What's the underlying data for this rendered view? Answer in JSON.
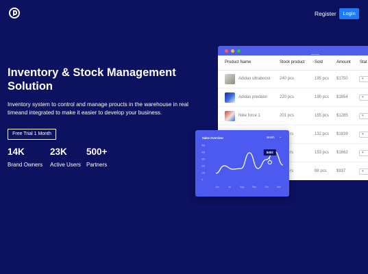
{
  "nav": {
    "register_label": "Register",
    "login_label": "Login"
  },
  "hero": {
    "title": "Inventory & Stock Management Solution",
    "description": "Inventory system to control and manage proucts in the warehouse in real timeand integrated to make it easier to develop your business.",
    "cta_label": "Free Trial 1 Month"
  },
  "stats": [
    {
      "value": "14K",
      "label": "Brand Owners"
    },
    {
      "value": "23K",
      "label": "Active Users"
    },
    {
      "value": "500+",
      "label": "Partners"
    }
  ],
  "table": {
    "columns": [
      "Product Name",
      "Stock product",
      "Sold",
      "Amount",
      "Stat"
    ],
    "rows": [
      {
        "name": "Adidas ultraboost",
        "stock": "240 pcs",
        "sold": "195 pcs",
        "amount": "$1750"
      },
      {
        "name": "Adidas predator",
        "stock": "220 pcs",
        "sold": "190 pcs",
        "amount": "$1854"
      },
      {
        "name": "Nike force 1",
        "stock": "201 pcs",
        "sold": "155 pcs",
        "amount": "$1285"
      },
      {
        "name": "",
        "stock": "rs",
        "sold": "132 pcs",
        "amount": "$1839"
      },
      {
        "name": "",
        "stock": "rs",
        "sold": "153 pcs",
        "amount": "$1662"
      },
      {
        "name": "",
        "stock": "rs",
        "sold": "98 pcs",
        "amount": "$937"
      }
    ],
    "colors": {
      "bar": "#4f5fec",
      "dot_red": "#ff5f57",
      "dot_yellow": "#febc2e",
      "dot_green": "#28c840"
    }
  },
  "chart_card": {
    "title": "Sales Overview",
    "period": "Month",
    "tooltip": "$402"
  },
  "chart_data": {
    "type": "line",
    "title": "Sales Overview",
    "x": [
      "Jan",
      "Feb",
      "Mar",
      "Apr",
      "May",
      "Jun",
      "Jul",
      "Aug",
      "Sep"
    ],
    "y_ticks": [
      "500",
      "400",
      "300",
      "200",
      "100",
      "0"
    ],
    "x_tick_labels": [
      "Jun",
      "Jul",
      "Aug",
      "Sep",
      "Oct",
      "Nov"
    ],
    "values": [
      90,
      200,
      150,
      160,
      390,
      160,
      290,
      410,
      210
    ],
    "ylim": [
      0,
      500
    ],
    "highlight": {
      "index": 7,
      "label": "$402"
    }
  }
}
